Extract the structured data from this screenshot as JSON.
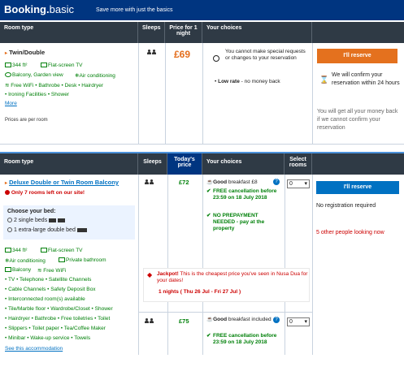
{
  "brand": {
    "name": "Booking.",
    "suffix": "basic",
    "tagline": "Save more with just the basics"
  },
  "table1": {
    "headers": [
      "Room type",
      "Sleeps",
      "Price for 1 night",
      "Your choices"
    ],
    "room_name": "Twin/Double",
    "facilities": [
      "344 ft²",
      "Flat-screen TV",
      "Balcony, Garden view",
      "Air conditioning",
      "Free WiFi • Bathrobe • Desk • Hairdryer",
      "• Ironing Facilities • Shower"
    ],
    "more_link": "More",
    "prices_note": "Prices are per room",
    "price": "£69",
    "choice_no_special": "You cannot make special requests or changes to your reservation",
    "choice_low_rate": "Low rate",
    "choice_low_rate_suffix": " - no money back",
    "reserve_label": "I'll reserve",
    "confirm_text": "We will confirm your reservation within 24 hours",
    "refund_text": "You will get all your money back if we cannot confirm your reservation"
  },
  "table2": {
    "headers": [
      "Room type",
      "Sleeps",
      "Today's price",
      "Your choices",
      "Select rooms"
    ],
    "room_name": "Deluxe Double or Twin Room Balcony",
    "rooms_left": "Only 7 rooms left on our site!",
    "choose_bed": "Choose your bed:",
    "bed_option_1": "2 single beds",
    "bed_option_2": "1 extra-large double bed",
    "facilities": [
      "344 ft²",
      "Flat-screen TV",
      "Air conditioning",
      "Private bathroom",
      "Balcony",
      "Free WiFi",
      "• TV • Telephone • Satellite Channels",
      "• Cable Channels • Safety Deposit Box",
      "• Interconnected room(s) available",
      "• Tile/Marble floor • Wardrobe/Closet • Shower",
      "• Hairdryer • Bathrobe • Free toiletries • Toilet",
      "• Slippers • Toilet paper • Tea/Coffee Maker",
      "• Minibar • Wake-up service • Towels"
    ],
    "see_link": "See this accommodation",
    "row1": {
      "price": "£72",
      "breakfast_label": "Good",
      "breakfast_suffix": " breakfast £8",
      "cancel": "FREE cancellation before 23:59 on 18 July 2018",
      "prepay": "NO PREPAYMENT NEEDED - pay at the property",
      "select_value": "0"
    },
    "row2": {
      "price": "£75",
      "breakfast_label": "Good",
      "breakfast_suffix": " breakfast included",
      "cancel": "FREE cancellation before 23:59 on 18 July 2018",
      "select_value": "0"
    },
    "reserve_label": "I'll reserve",
    "no_registration": "No registration required",
    "others_looking": "5 other people looking now",
    "jackpot_label": "Jackpot!",
    "jackpot_text": " This is the cheapest price you've seen in Nusa Dua for your dates!",
    "nights_text": "1 nights ( Thu 26 Jul - Fri 27 Jul )"
  },
  "colors": {
    "topbar": "#003580",
    "header": "#2f3a45",
    "header_active": "#003580",
    "reserve_orange": "#e4711e",
    "reserve_blue": "#0071c2",
    "green": "#008009",
    "red": "#cc0000"
  }
}
